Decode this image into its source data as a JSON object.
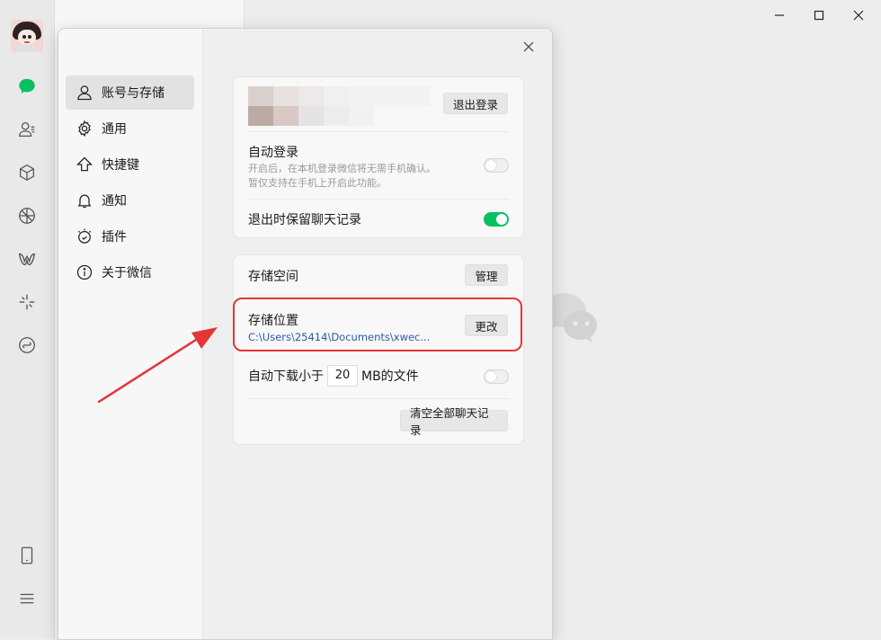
{
  "nav": {
    "items": [
      {
        "label": "账号与存储",
        "icon": "user-icon"
      },
      {
        "label": "通用",
        "icon": "gear-icon"
      },
      {
        "label": "快捷键",
        "icon": "arrow-up-icon"
      },
      {
        "label": "通知",
        "icon": "bell-icon"
      },
      {
        "label": "插件",
        "icon": "plugin-icon"
      },
      {
        "label": "关于微信",
        "icon": "info-icon"
      }
    ],
    "active_index": 0
  },
  "account": {
    "logout_label": "退出登录"
  },
  "auto_login": {
    "label": "自动登录",
    "desc1": "开启后，在本机登录微信将无需手机确认。",
    "desc2": "暂仅支持在手机上开启此功能。",
    "enabled": false
  },
  "keep_history": {
    "label": "退出时保留聊天记录",
    "enabled": true
  },
  "storage": {
    "space_label": "存储空间",
    "manage_label": "管理",
    "location_label": "存储位置",
    "location_path": "C:\\Users\\25414\\Documents\\xwec...",
    "change_label": "更改",
    "auto_download_prefix": "自动下载小于",
    "auto_download_value": "20",
    "auto_download_suffix": "MB的文件",
    "auto_download_enabled": false,
    "clear_label": "清空全部聊天记录"
  },
  "colors": {
    "accent": "#07c160",
    "highlight": "#e53535"
  }
}
